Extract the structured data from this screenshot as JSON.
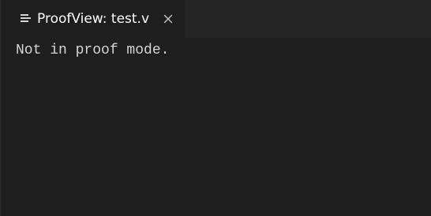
{
  "tab": {
    "title": "ProofView: test.v",
    "icon": "preview-lines-icon",
    "close_icon": "close-icon"
  },
  "content": {
    "message": "Not in proof mode."
  },
  "colors": {
    "editor_background": "#1e1e1e",
    "tab_bar_background": "#252526",
    "active_tab_text": "#ffffff",
    "content_text": "#d4d4d4"
  }
}
